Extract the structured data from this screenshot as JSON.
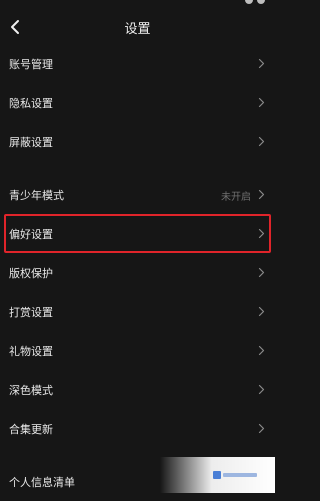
{
  "header": {
    "title": "设置"
  },
  "menu": {
    "group1": [
      {
        "label": "账号管理"
      },
      {
        "label": "隐私设置"
      },
      {
        "label": "屏蔽设置"
      }
    ],
    "group2": [
      {
        "label": "青少年模式",
        "value": "未开启"
      },
      {
        "label": "偏好设置",
        "highlighted": true
      },
      {
        "label": "版权保护"
      },
      {
        "label": "打赏设置"
      },
      {
        "label": "礼物设置"
      },
      {
        "label": "深色模式"
      },
      {
        "label": "合集更新"
      }
    ],
    "group3": [
      {
        "label": "个人信息清单"
      }
    ]
  },
  "colors": {
    "background": "#161616",
    "highlight_border": "#e0242a",
    "value_text": "#6f6f6f"
  },
  "icons": {
    "back": "chevron-left-icon",
    "row_arrow": "chevron-right-icon"
  }
}
